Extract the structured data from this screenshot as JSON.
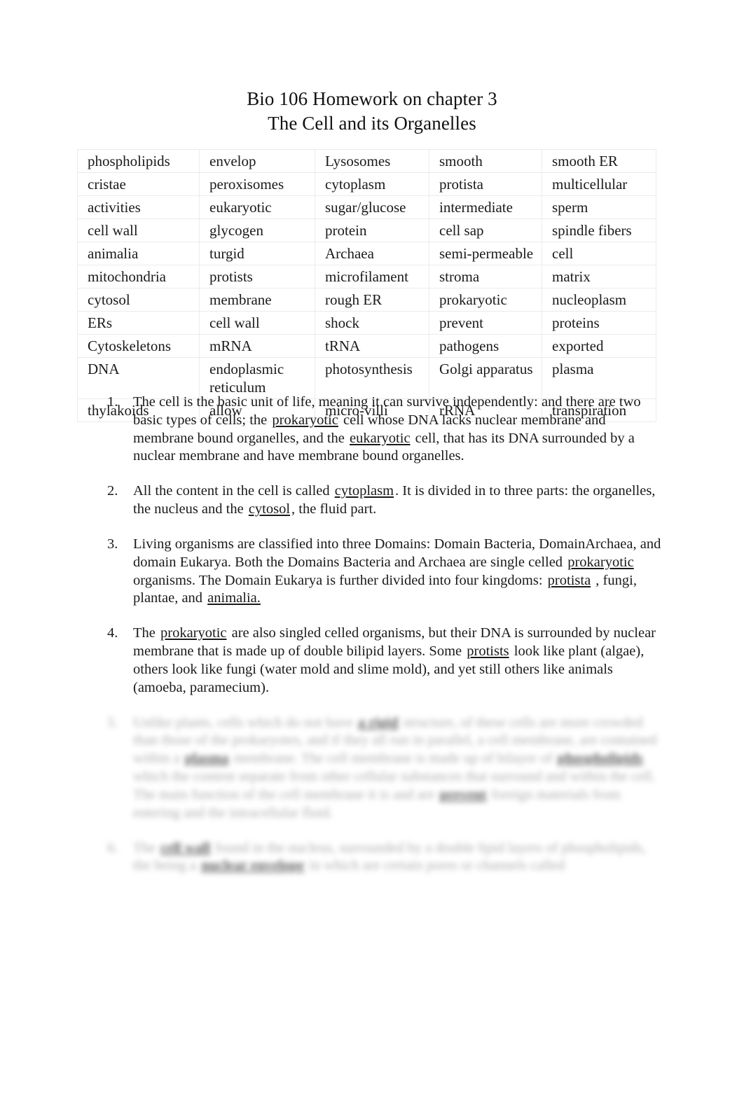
{
  "document": {
    "title_lines": [
      "Bio 106 Homework on chapter 3",
      "The Cell and its Organelles"
    ]
  },
  "word_bank": {
    "rows": [
      [
        "phospholipids",
        "envelop",
        "Lysosomes",
        "smooth",
        "smooth ER"
      ],
      [
        "cristae",
        "peroxisomes",
        "cytoplasm",
        "protista",
        "multicellular"
      ],
      [
        "activities",
        "eukaryotic",
        "sugar/glucose",
        "intermediate",
        "sperm"
      ],
      [
        "cell wall",
        "glycogen",
        "protein",
        "cell sap",
        "spindle fibers"
      ],
      [
        "animalia",
        "turgid",
        "Archaea",
        "semi-permeable",
        "cell"
      ],
      [
        "mitochondria",
        "protists",
        "microfilament",
        "stroma",
        "matrix"
      ],
      [
        "cytosol",
        "membrane",
        "rough ER",
        "prokaryotic",
        "nucleoplasm"
      ],
      [
        "ERs",
        "cell wall",
        "shock",
        "prevent",
        "proteins"
      ],
      [
        "Cytoskeletons",
        "mRNA",
        "tRNA",
        "pathogens",
        "exported"
      ],
      [
        "DNA",
        "endoplasmic reticulum",
        "photosynthesis",
        "Golgi apparatus",
        "plasma"
      ],
      [
        "thylakoids",
        "allow",
        "micro-villi",
        "rRNA",
        "transpiration"
      ]
    ]
  },
  "questions": [
    {
      "number": "1.",
      "blurred": false,
      "parts": [
        {
          "t": "The cell is the basic unit of life, meaning it can survive independently: and there are two basic types of cells; the ",
          "b": false
        },
        {
          "t": "prokaryotic",
          "b": true
        },
        {
          "t": " cell whose DNA lacks nuclear membrane and membrane bound organelles, and the ",
          "b": false
        },
        {
          "t": "  eukaryotic",
          "b": true
        },
        {
          "t": " cell, that has its DNA surrounded by a nuclear membrane and have membrane bound organelles.",
          "b": false
        }
      ]
    },
    {
      "number": "2.",
      "blurred": false,
      "parts": [
        {
          "t": "All the content in the cell is called ",
          "b": false
        },
        {
          "t": "cytoplasm",
          "b": true
        },
        {
          "t": ". It is divided in to three parts: the organelles, the nucleus and the ",
          "b": false
        },
        {
          "t": " cytosol",
          "b": true
        },
        {
          "t": ", the fluid part.",
          "b": false
        }
      ]
    },
    {
      "number": "3.",
      "blurred": false,
      "parts": [
        {
          "t": "Living organisms are classified into three Domains: Domain Bacteria, DomainArchaea, and domain Eukarya. Both the Domains Bacteria and Archaea are single celled ",
          "b": false
        },
        {
          "t": "prokaryotic",
          "b": true
        },
        {
          "t": " organisms. The Domain Eukarya is further divided into four kingdoms: ",
          "b": false
        },
        {
          "t": "protista",
          "b": true
        },
        {
          "t": " , fungi, plantae, and ",
          "b": false
        },
        {
          "t": "animalia.",
          "b": true
        }
      ]
    },
    {
      "number": "4.",
      "blurred": false,
      "parts": [
        {
          "t": "The ",
          "b": false
        },
        {
          "t": "prokaryotic",
          "b": true
        },
        {
          "t": " are also singled celled organisms, but their DNA is surrounded by nuclear membrane that is made up of double bilipid layers. Some ",
          "b": false
        },
        {
          "t": " protists",
          "b": true
        },
        {
          "t": " look like plant (algae), others look like fungi (water mold and slime mold), and yet still others like animals (amoeba, paramecium).",
          "b": false
        }
      ]
    },
    {
      "number": "5.",
      "blurred": true,
      "parts": [
        {
          "t": "Unlike plants, cells which do not have ",
          "b": false
        },
        {
          "t": "a rigid",
          "b": true
        },
        {
          "t": " structure, of these cells are more crowded than those of the prokaryotes, and if they all run in parallel, a cell membrane, are contained within a ",
          "b": false
        },
        {
          "t": "plasma",
          "b": true
        },
        {
          "t": " membrane. The cell membrane is made up of bilayer of ",
          "b": false
        },
        {
          "t": "phospholipids",
          "b": true
        },
        {
          "t": " which the content separate from other cellular substances that surround and within the cell. The main function of the cell membrane it is and are ",
          "b": false
        },
        {
          "t": "prevent",
          "b": true
        },
        {
          "t": " foreign materials from entering and the intracellular fluid.",
          "b": false
        }
      ]
    },
    {
      "number": "6.",
      "blurred": true,
      "parts": [
        {
          "t": "The ",
          "b": false
        },
        {
          "t": "cell wall",
          "b": true
        },
        {
          "t": " found in the nucleus, surrounded by a double lipid layers of phospholipids, the being a ",
          "b": false
        },
        {
          "t": "nuclear envelope",
          "b": true
        },
        {
          "t": " in which are certain pores or channels called",
          "b": false
        }
      ]
    }
  ]
}
